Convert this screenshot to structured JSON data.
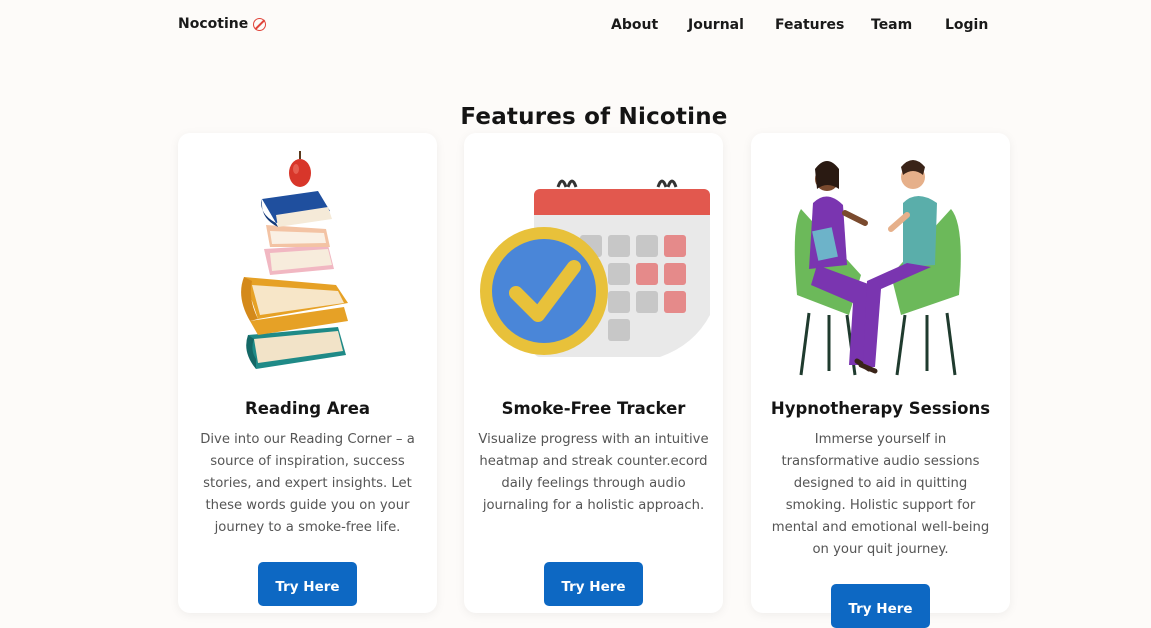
{
  "nav": {
    "brand": "Nocotine",
    "brand_icon": "no-smoking-icon",
    "links": [
      "About",
      "Journal",
      "Features",
      "Team",
      "Login"
    ]
  },
  "section": {
    "title": "Features of Nicotine"
  },
  "cards": [
    {
      "title": "Reading Area",
      "description": "Dive into our Reading Corner – a source of inspiration, success stories, and expert insights. Let these words guide you on your journey to a smoke-free life.",
      "button": "Try Here",
      "illustration": "stacked-books-apple-illustration"
    },
    {
      "title": "Smoke-Free Tracker",
      "description": "Visualize progress with an intuitive heatmap and streak counter.ecord daily feelings through audio journaling for a holistic approach.",
      "button": "Try Here",
      "illustration": "calendar-checkmark-illustration"
    },
    {
      "title": "Hypnotherapy Sessions",
      "description": "Immerse yourself in transformative audio sessions designed to aid in quitting smoking. Holistic support for mental and emotional well-being on your quit journey.",
      "button": "Try Here",
      "illustration": "therapy-session-illustration"
    }
  ],
  "colors": {
    "background": "#fdfbf9",
    "card": "#ffffff",
    "button": "#0d68c3",
    "brand_icon": "#e0443a"
  }
}
